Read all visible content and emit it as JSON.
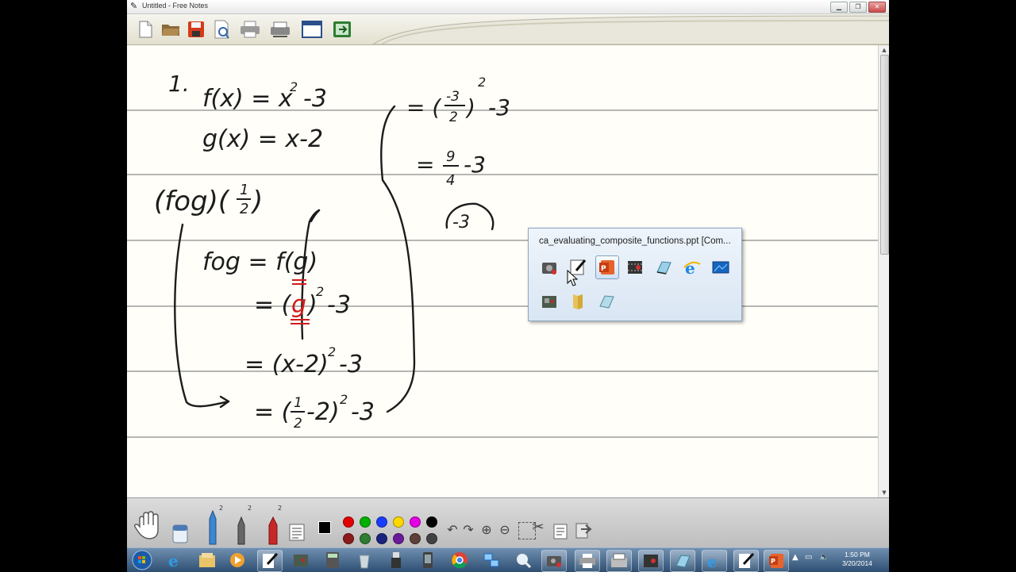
{
  "window": {
    "title": "Untitled - Free Notes",
    "controls": [
      "minimize",
      "maximize",
      "close"
    ]
  },
  "toolbar": {
    "icons": [
      "new-document-icon",
      "open-folder-icon",
      "save-icon",
      "print-preview-icon",
      "print-icon",
      "scanner-icon",
      "window-icon",
      "export-icon"
    ]
  },
  "popup": {
    "title": "ca_evaluating_composite_functions.ppt [Com...",
    "row1": [
      "camstudio-icon",
      "free-notes-icon",
      "powerpoint-icon",
      "video-editor-icon",
      "notepad-icon",
      "internet-explorer-icon",
      "desktop-icon"
    ],
    "row2": [
      "recorder-icon",
      "folder-icon",
      "notebook-icon"
    ],
    "active_index": 2
  },
  "penbar": {
    "pen_sizes": [
      "2",
      "2",
      "2"
    ],
    "colors_row1": [
      "#e00000",
      "#00b000",
      "#1a3cff",
      "#ffd800",
      "#e400e4",
      "#000000"
    ],
    "colors_row2": [
      "#8b1a1a",
      "#2e7d32",
      "#1a237e",
      "#6a1b9a",
      "#5d4037",
      "#424242"
    ],
    "tools": [
      "hand-tool-icon",
      "eraser-icon",
      "pen-icon",
      "pencil-icon",
      "marker-icon",
      "lines-icon",
      "black-fill-icon",
      "undo-icon",
      "redo-icon",
      "zoom-in-icon",
      "zoom-out-icon",
      "select-icon",
      "cut-icon",
      "paste-icon",
      "page-icon"
    ]
  },
  "notes": {
    "problem_number": "1.",
    "lines": [
      "f(x) = x^2 - 3",
      "g(x) = x - 2",
      "(f∘g)(1/2)",
      "f∘g = f(g)",
      "= (g)^2 - 3",
      "= (x-2)^2 - 3",
      "= (1/2 - 2)^2 - 3",
      "= (-3/2)^2 - 3",
      "= 9/4 - 3",
      "-3"
    ]
  },
  "taskbar": {
    "apps": [
      "start-orb",
      "internet-explorer-icon",
      "file-explorer-icon",
      "media-player-icon",
      "free-notes-icon",
      "recorder-icon",
      "calculator-icon",
      "recycle-bin-icon",
      "usb-icon",
      "phone-icon",
      "chrome-icon",
      "network-icon",
      "magnifier-icon",
      "camstudio-icon",
      "printer-icon",
      "fax-icon",
      "video-editor-icon",
      "notepad-icon",
      "internet-explorer-icon",
      "free-notes-icon",
      "powerpoint-icon"
    ],
    "clock_time": "1:50 PM",
    "clock_date": "3/20/2014"
  }
}
